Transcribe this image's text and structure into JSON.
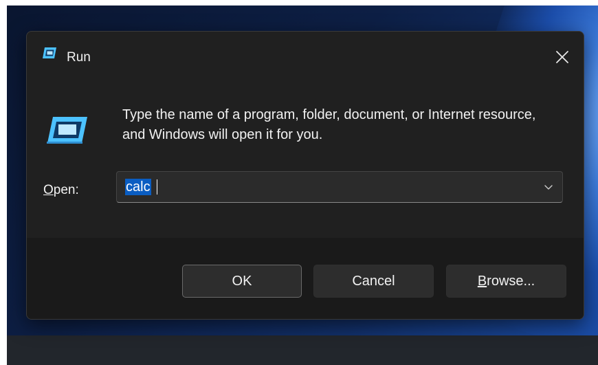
{
  "dialog": {
    "title": "Run",
    "description": "Type the name of a program, folder, document, or Internet resource, and Windows will open it for you.",
    "open_label_mnemonic": "O",
    "open_label_rest": "pen:",
    "input_value": "calc",
    "buttons": {
      "ok": "OK",
      "cancel": "Cancel",
      "browse_mnemonic": "B",
      "browse_rest": "rowse..."
    }
  },
  "icons": {
    "title": "run-icon",
    "body": "run-icon",
    "close": "close-icon",
    "dropdown": "chevron-down-icon"
  },
  "colors": {
    "dialog_bg": "#202020",
    "footer_bg": "#1a1a1a",
    "selection": "#0a5dc2",
    "accent_icon": "#4cc2ff"
  }
}
